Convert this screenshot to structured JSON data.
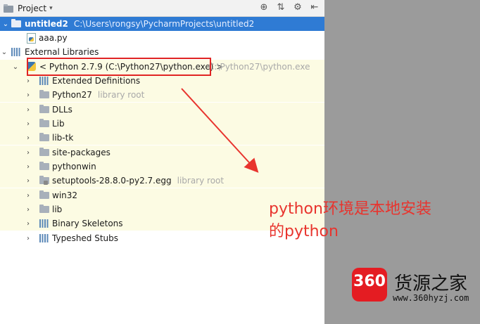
{
  "header": {
    "title": "Project",
    "caret": "▾"
  },
  "tree": {
    "project": {
      "name": "untitled2",
      "path": "C:\\Users\\rongsy\\PycharmProjects\\untitled2"
    },
    "file": "aaa.py",
    "external": "External Libraries",
    "python_sdk": {
      "name": "< Python 2.7.9 (C:\\Python27\\python.exe) >",
      "path": "C:\\Python27\\python.exe"
    },
    "items": [
      {
        "label": "Extended Definitions",
        "hint": ""
      },
      {
        "label": "Python27",
        "hint": "library root"
      },
      {
        "label": "DLLs",
        "hint": ""
      },
      {
        "label": "Lib",
        "hint": ""
      },
      {
        "label": "lib-tk",
        "hint": ""
      },
      {
        "label": "site-packages",
        "hint": ""
      },
      {
        "label": "pythonwin",
        "hint": ""
      },
      {
        "label": "setuptools-28.8.0-py2.7.egg",
        "hint": "library root"
      },
      {
        "label": "win32",
        "hint": ""
      },
      {
        "label": "lib",
        "hint": ""
      },
      {
        "label": "Binary Skeletons",
        "hint": ""
      },
      {
        "label": "Typeshed Stubs",
        "hint": ""
      }
    ]
  },
  "annotation": {
    "line1": "python环境是本地安装",
    "line2": "的python"
  },
  "watermark": {
    "logo": "360",
    "name": "货源之家",
    "url": "www.360hyzj.com"
  },
  "colors": {
    "selection": "#2f7bd4",
    "library_bg": "#fcfbe3",
    "annotation": "#e8342e"
  }
}
